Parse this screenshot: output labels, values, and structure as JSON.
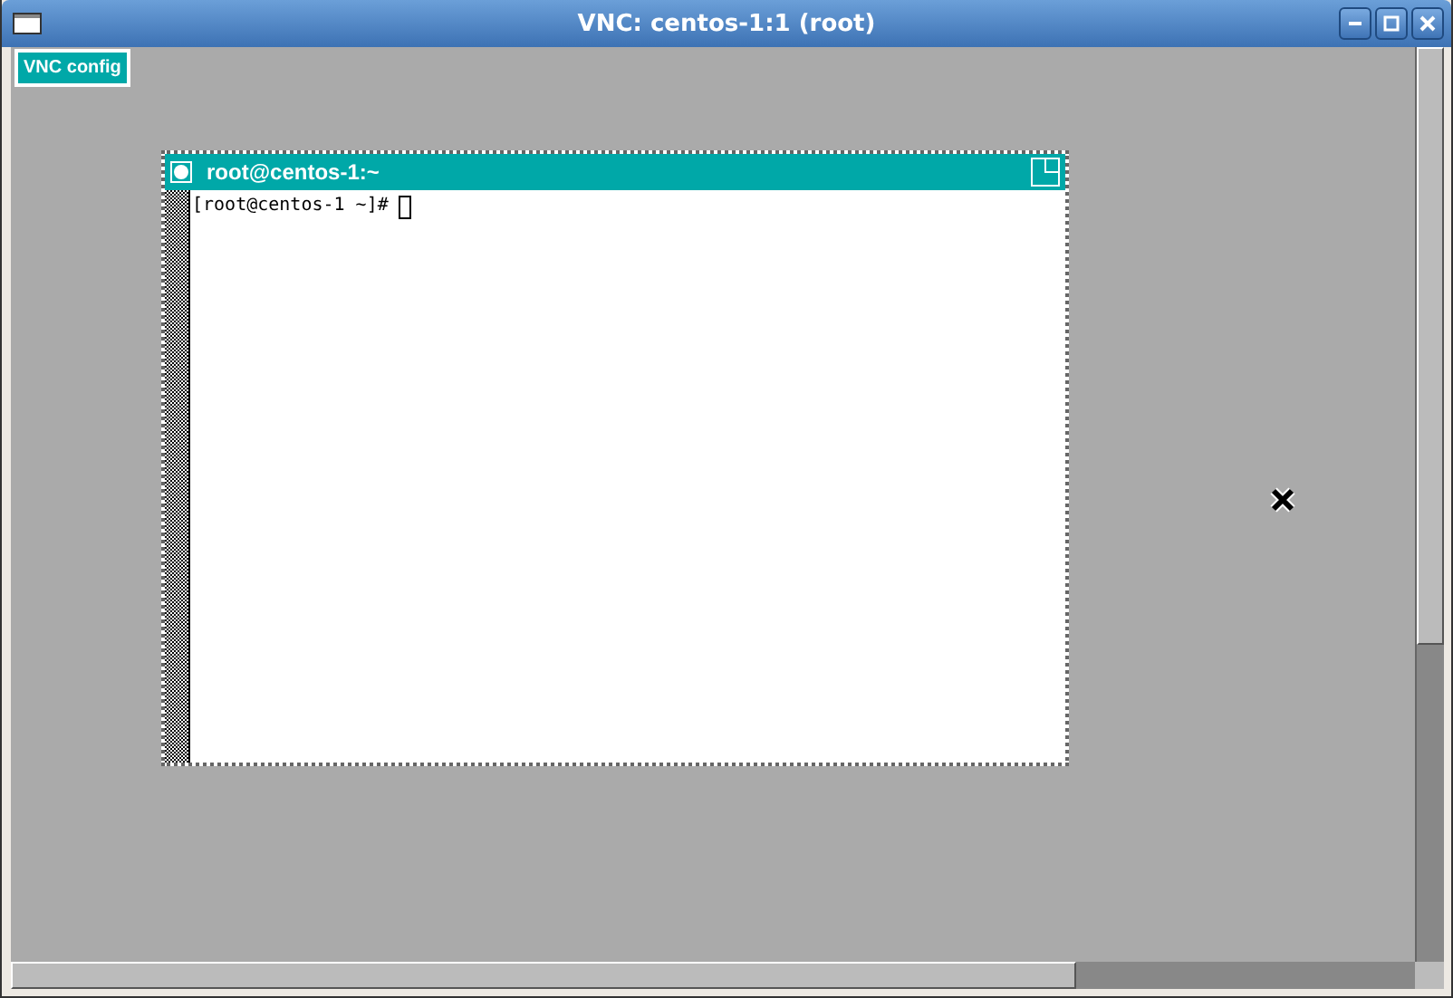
{
  "window": {
    "title": "VNC: centos-1:1 (root)"
  },
  "config_button": {
    "label": "VNC config"
  },
  "terminal": {
    "title": "root@centos-1:~",
    "prompt": "[root@centos-1 ~]# "
  }
}
